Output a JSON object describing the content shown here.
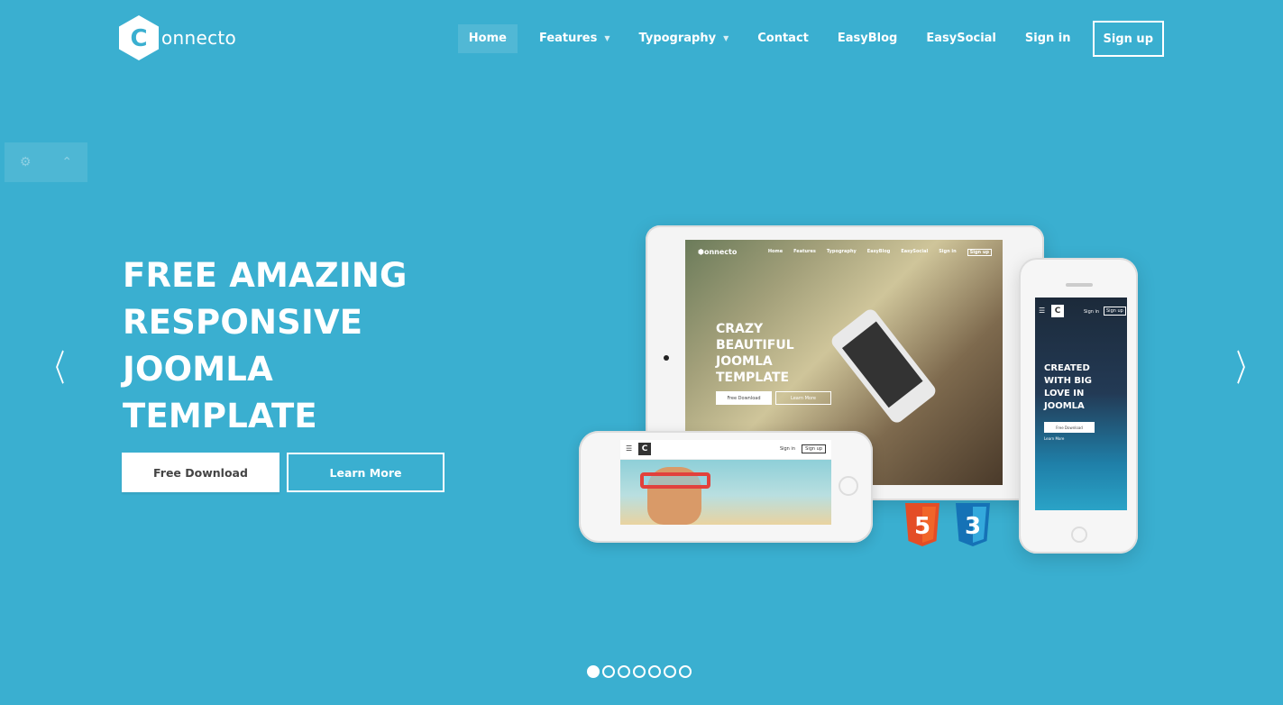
{
  "brand": {
    "name": "onnecto",
    "mark": "C"
  },
  "nav": {
    "items": [
      {
        "label": "Home",
        "active": true
      },
      {
        "label": "Features",
        "dropdown": true
      },
      {
        "label": "Typography",
        "dropdown": true
      },
      {
        "label": "Contact"
      },
      {
        "label": "EasyBlog"
      },
      {
        "label": "EasySocial"
      },
      {
        "label": "Sign in"
      }
    ],
    "signup": "Sign up"
  },
  "hero": {
    "title_lines": [
      "FREE AMAZING",
      "RESPONSIVE",
      "JOOMLA",
      "TEMPLATE"
    ],
    "primary_button": "Free Download",
    "secondary_button": "Learn More",
    "prev_arrow": "〈",
    "next_arrow": "〉"
  },
  "slider": {
    "dot_count": 7,
    "active_index": 0
  },
  "side_widget": {
    "icons": [
      "gear-icon",
      "chevron-up-icon"
    ]
  },
  "devices": {
    "tablet": {
      "logo": "onnecto",
      "nav": [
        "Home",
        "Features",
        "Typography",
        "EasyBlog",
        "EasySocial",
        "Sign in",
        "Sign up"
      ],
      "title_lines": [
        "CRAZY",
        "BEAUTIFUL",
        "JOOMLA",
        "TEMPLATE"
      ],
      "btn1": "Free Download",
      "btn2": "Learn More"
    },
    "phone_landscape": {
      "sign_in": "Sign in",
      "sign_up": "Sign up"
    },
    "phone_portrait": {
      "sign_in": "Sign in",
      "sign_up": "Sign up",
      "title_lines": [
        "CREATED",
        "WITH BIG",
        "LOVE IN",
        "JOOMLA"
      ],
      "btn1": "Free Download",
      "btn2": "Learn More"
    },
    "badges": [
      "5",
      "3"
    ]
  },
  "colors": {
    "background": "#3aafd0",
    "html5": "#e44d26",
    "css3": "#1572b6"
  }
}
